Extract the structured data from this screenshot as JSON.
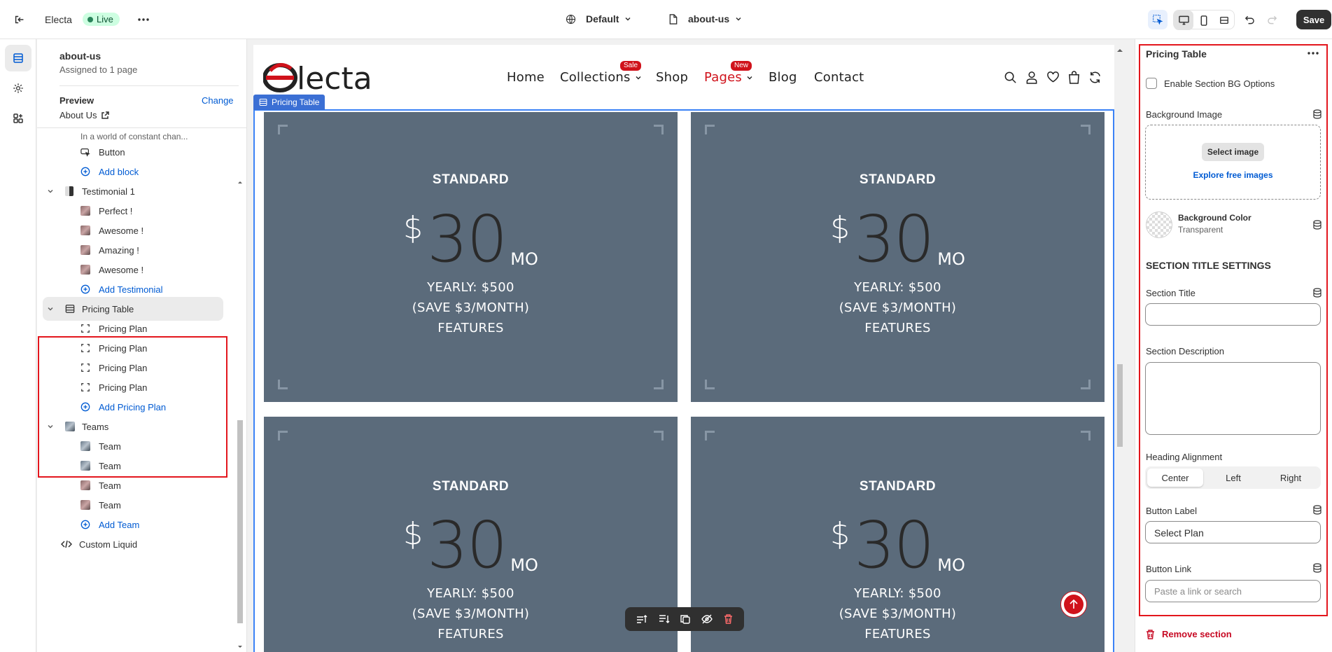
{
  "topbar": {
    "store_name": "Electa",
    "status": "Live",
    "theme_selector": "Default",
    "template_selector": "about-us",
    "save_label": "Save"
  },
  "sidebar": {
    "template_title": "about-us",
    "template_sub": "Assigned to 1 page",
    "preview_label": "Preview",
    "preview_change": "Change",
    "preview_page": "About Us",
    "truncated_text": "In a world of constant chan...",
    "items": {
      "button": "Button",
      "add_block": "Add block",
      "testimonial_section": "Testimonial 1",
      "testimonials": [
        "Perfect !",
        "Awesome !",
        "Amazing !",
        "Awesome !"
      ],
      "add_testimonial": "Add Testimonial",
      "pricing_section": "Pricing Table",
      "pricing_plans": [
        "Pricing Plan",
        "Pricing Plan",
        "Pricing Plan",
        "Pricing Plan"
      ],
      "add_pricing_plan": "Add Pricing Plan",
      "teams_section": "Teams",
      "teams": [
        "Team",
        "Team",
        "Team",
        "Team"
      ],
      "add_team": "Add Team",
      "custom_liquid": "Custom Liquid"
    }
  },
  "preview": {
    "nav": {
      "home": "Home",
      "collections": "Collections",
      "collections_badge": "Sale",
      "shop": "Shop",
      "pages": "Pages",
      "pages_badge": "New",
      "blog": "Blog",
      "contact": "Contact"
    },
    "section_tag": "Pricing Table",
    "cards": [
      {
        "plan": "STANDARD",
        "currency": "$",
        "amount": "30",
        "period": "MO",
        "yearly": "YEARLY: $500",
        "save": "(SAVE $3/MONTH)",
        "features": "FEATURES"
      },
      {
        "plan": "STANDARD",
        "currency": "$",
        "amount": "30",
        "period": "MO",
        "yearly": "YEARLY: $500",
        "save": "(SAVE $3/MONTH)",
        "features": "FEATURES"
      },
      {
        "plan": "STANDARD",
        "currency": "$",
        "amount": "30",
        "period": "MO",
        "yearly": "YEARLY: $500",
        "save": "(SAVE $3/MONTH)",
        "features": "FEATURES"
      },
      {
        "plan": "STANDARD",
        "currency": "$",
        "amount": "30",
        "period": "MO",
        "yearly": "YEARLY: $500",
        "save": "(SAVE $3/MONTH)",
        "features": "FEATURES"
      }
    ]
  },
  "panel": {
    "title": "Pricing Table",
    "enable_bg": "Enable Section BG Options",
    "bg_image_label": "Background Image",
    "select_image": "Select image",
    "explore_images": "Explore free images",
    "bg_color_label": "Background Color",
    "bg_color_value": "Transparent",
    "section_title_settings": "SECTION TITLE SETTINGS",
    "section_title_label": "Section Title",
    "section_title_value": "",
    "section_desc_label": "Section Description",
    "section_desc_value": "",
    "heading_alignment_label": "Heading Alignment",
    "alignments": [
      "Center",
      "Left",
      "Right"
    ],
    "selected_alignment": "Center",
    "button_label_label": "Button Label",
    "button_label_value": "Select Plan",
    "button_link_label": "Button Link",
    "button_link_placeholder": "Paste a link or search",
    "remove_section": "Remove section"
  },
  "colors": {
    "accent_blue": "#005bd3",
    "card_bg": "#5b6b7b",
    "brand_red": "#d0121b",
    "highlight_red": "#e3161d"
  }
}
